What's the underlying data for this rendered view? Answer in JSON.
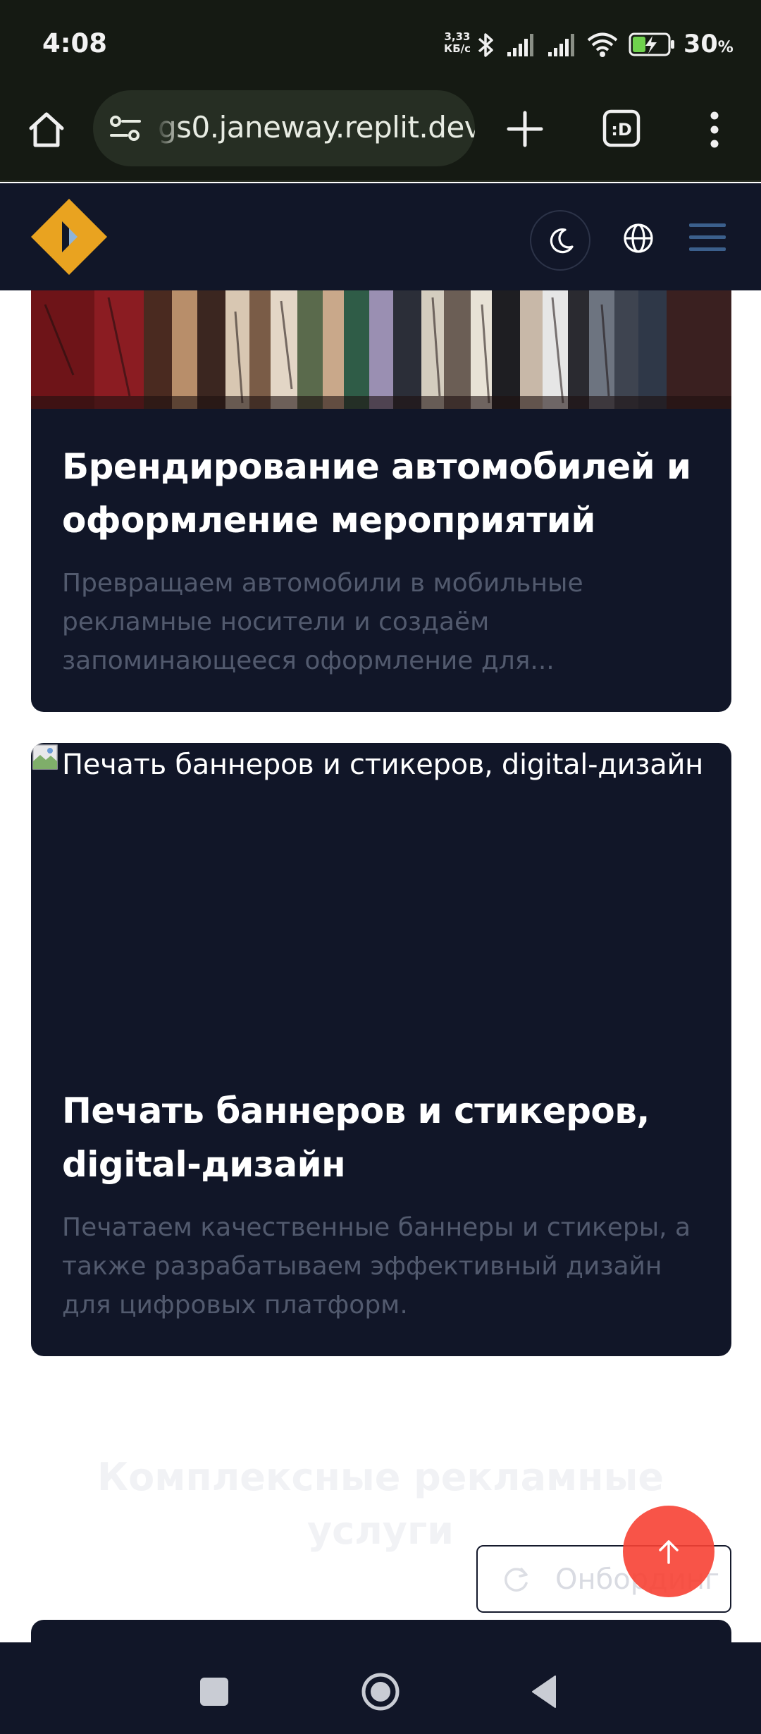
{
  "status_bar": {
    "time": "4:08",
    "net_speed_value": "3,33",
    "net_speed_unit": "КБ/с",
    "battery_percent": "30",
    "battery_unit": "%",
    "icons": [
      "bluetooth-icon",
      "signal-icon",
      "signal-icon",
      "wifi-icon",
      "battery-charging-icon"
    ]
  },
  "browser": {
    "url": "gs0.janeway.replit.dev",
    "icons": [
      "home-icon",
      "site-settings-icon",
      "plus-icon",
      "tab-switcher-icon",
      "more-vert-icon"
    ],
    "tab_switcher_label": ":D"
  },
  "header": {
    "icons": [
      "logo",
      "moon-icon",
      "globe-icon",
      "hamburger-icon"
    ]
  },
  "cards": [
    {
      "title": "Брендирование автомобилей и оформление мероприятий",
      "description": "Превращаем автомобили в мобильные рекламные носители и создаём запоминающееся оформление для..."
    },
    {
      "image_alt": "Печать баннеров и стикеров, digital-дизайн",
      "title": "Печать баннеров и стикеров, digital-дизайн",
      "description": "Печатаем качественные баннеры и стикеры, а также разрабатываем эффективный дизайн для цифровых платформ."
    }
  ],
  "section": {
    "title": "Комплексные рекламные услуги"
  },
  "onboarding": {
    "label": "Онбординг"
  },
  "nav_bar": {
    "icons": [
      "recents-icon",
      "home-circle-icon",
      "back-icon"
    ]
  },
  "colors": {
    "page_dark": "#111628",
    "browser_bg": "#151a13",
    "url_pill": "#262e23",
    "logo_orange": "#e9a320",
    "scroll_top": "#f74134",
    "muted_text": "#525a6e"
  }
}
